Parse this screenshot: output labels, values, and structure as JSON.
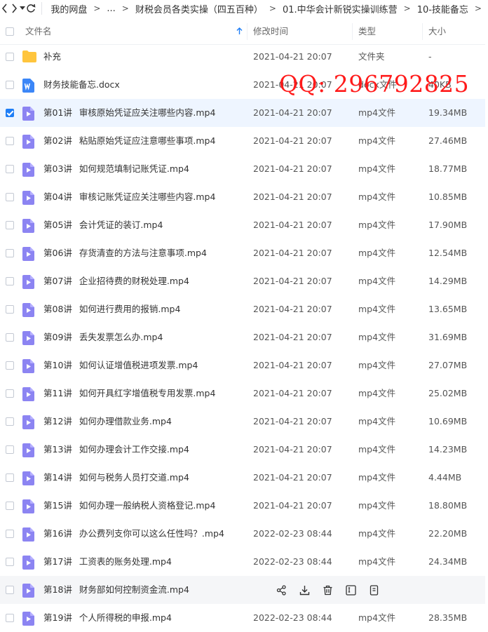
{
  "breadcrumb": {
    "root": "我的网盘",
    "ellipsis": "...",
    "items": [
      "财税会员各类实操（四五百种）",
      "01.中华会计新锐实操训练营",
      "10-技能备忘"
    ],
    "separator": ">"
  },
  "columns": {
    "name": "文件名",
    "date": "修改时间",
    "type": "类型",
    "size": "大小"
  },
  "watermark": "QQ: 296792825",
  "files": [
    {
      "prefix": "",
      "name": "补充",
      "date": "2021-04-21 20:07",
      "type": "文件夹",
      "size": "-",
      "icon": "folder-icon"
    },
    {
      "prefix": "",
      "name": "财务技能备忘.docx",
      "date": "2021-04-21 20:07",
      "type": "docx文件",
      "size": "40KB",
      "icon": "word-doc-icon"
    },
    {
      "prefix": "第01讲",
      "name": "审核原始凭证应关注哪些内容.mp4",
      "date": "2021-04-21 20:07",
      "type": "mp4文件",
      "size": "19.34MB",
      "icon": "video-file-icon"
    },
    {
      "prefix": "第02讲",
      "name": "粘贴原始凭证应注意哪些事项.mp4",
      "date": "2021-04-21 20:07",
      "type": "mp4文件",
      "size": "27.46MB",
      "icon": "video-file-icon"
    },
    {
      "prefix": "第03讲",
      "name": "如何规范填制记账凭证.mp4",
      "date": "2021-04-21 20:07",
      "type": "mp4文件",
      "size": "18.77MB",
      "icon": "video-file-icon"
    },
    {
      "prefix": "第04讲",
      "name": "审核记账凭证应关注哪些内容.mp4",
      "date": "2021-04-21 20:07",
      "type": "mp4文件",
      "size": "10.85MB",
      "icon": "video-file-icon"
    },
    {
      "prefix": "第05讲",
      "name": "会计凭证的装订.mp4",
      "date": "2021-04-21 20:07",
      "type": "mp4文件",
      "size": "17.90MB",
      "icon": "video-file-icon"
    },
    {
      "prefix": "第06讲",
      "name": "存货清查的方法与注意事项.mp4",
      "date": "2021-04-21 20:07",
      "type": "mp4文件",
      "size": "12.54MB",
      "icon": "video-file-icon"
    },
    {
      "prefix": "第07讲",
      "name": "企业招待费的财税处理.mp4",
      "date": "2021-04-21 20:07",
      "type": "mp4文件",
      "size": "14.29MB",
      "icon": "video-file-icon"
    },
    {
      "prefix": "第08讲",
      "name": "如何进行费用的报销.mp4",
      "date": "2021-04-21 20:07",
      "type": "mp4文件",
      "size": "13.65MB",
      "icon": "video-file-icon"
    },
    {
      "prefix": "第09讲",
      "name": "丢失发票怎么办.mp4",
      "date": "2021-04-21 20:07",
      "type": "mp4文件",
      "size": "31.69MB",
      "icon": "video-file-icon"
    },
    {
      "prefix": "第10讲",
      "name": "如何认证增值税进项发票.mp4",
      "date": "2021-04-21 20:07",
      "type": "mp4文件",
      "size": "27.07MB",
      "icon": "video-file-icon"
    },
    {
      "prefix": "第11讲",
      "name": "如何开具红字增值税专用发票.mp4",
      "date": "2021-04-21 20:07",
      "type": "mp4文件",
      "size": "25.02MB",
      "icon": "video-file-icon"
    },
    {
      "prefix": "第12讲",
      "name": "如何办理借款业务.mp4",
      "date": "2021-04-21 20:07",
      "type": "mp4文件",
      "size": "10.69MB",
      "icon": "video-file-icon"
    },
    {
      "prefix": "第13讲",
      "name": "如何办理会计工作交接.mp4",
      "date": "2021-04-21 20:07",
      "type": "mp4文件",
      "size": "14.23MB",
      "icon": "video-file-icon"
    },
    {
      "prefix": "第14讲",
      "name": "如何与税务人员打交道.mp4",
      "date": "2021-04-21 20:07",
      "type": "mp4文件",
      "size": "4.44MB",
      "icon": "video-file-icon"
    },
    {
      "prefix": "第15讲",
      "name": "如何办理一般纳税人资格登记.mp4",
      "date": "2021-04-21 20:07",
      "type": "mp4文件",
      "size": "18.80MB",
      "icon": "video-file-icon"
    },
    {
      "prefix": "第16讲",
      "name": "办公费列支你可以这么任性吗？.mp4",
      "date": "2022-02-23 08:44",
      "type": "mp4文件",
      "size": "22.20MB",
      "icon": "video-file-icon"
    },
    {
      "prefix": "第17讲",
      "name": "工资表的账务处理.mp4",
      "date": "2022-02-23 08:44",
      "type": "mp4文件",
      "size": "24.34MB",
      "icon": "video-file-icon"
    },
    {
      "prefix": "第18讲",
      "name": "财务部如何控制资金流.mp4",
      "date": "",
      "type": "",
      "size": "",
      "icon": "video-file-icon"
    },
    {
      "prefix": "第19讲",
      "name": "个人所得税的申报.mp4",
      "date": "2022-02-23 08:44",
      "type": "mp4文件",
      "size": "28.35MB",
      "icon": "video-file-icon"
    }
  ],
  "selected_index": 2,
  "hover_index": 19,
  "hover_actions": [
    "share-icon",
    "download-icon",
    "delete-icon",
    "rename-icon",
    "copy-icon"
  ],
  "colors": {
    "accent": "#1f7ef6",
    "folder": "#ffc53d",
    "word": "#3b86f7",
    "video": "#8c84f2",
    "watermark": "#ff1a1a"
  }
}
